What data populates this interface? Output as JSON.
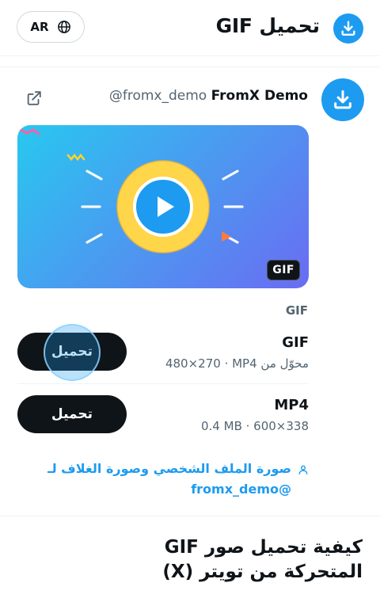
{
  "header": {
    "title": "تحميل GIF",
    "lang_label": "AR",
    "icon": "download-circle-icon",
    "globe_icon": "globe-icon"
  },
  "tweet": {
    "author_name": "FromX Demo",
    "author_handle": "@fromx_demo",
    "avatar_icon": "download-circle-icon",
    "external_icon": "external-link-icon",
    "media_badge": "GIF",
    "media_type_label": "GIF"
  },
  "downloads": [
    {
      "title": "GIF",
      "meta": "480×270 · MP4 محوّل من",
      "button_label": "تحميل"
    },
    {
      "title": "MP4",
      "meta": "0.4 MB · 600×338",
      "button_label": "تحميل"
    }
  ],
  "profile_link": {
    "text": "صورة الملف الشخصي وصورة الغلاف لـ @fromx_demo",
    "icon": "user-icon"
  },
  "howto": {
    "title": "كيفية تحميل صور GIF المتحركة من تويتر (X)"
  },
  "colors": {
    "accent": "#1d9bf0",
    "dark": "#0f1419",
    "muted": "#536471"
  }
}
